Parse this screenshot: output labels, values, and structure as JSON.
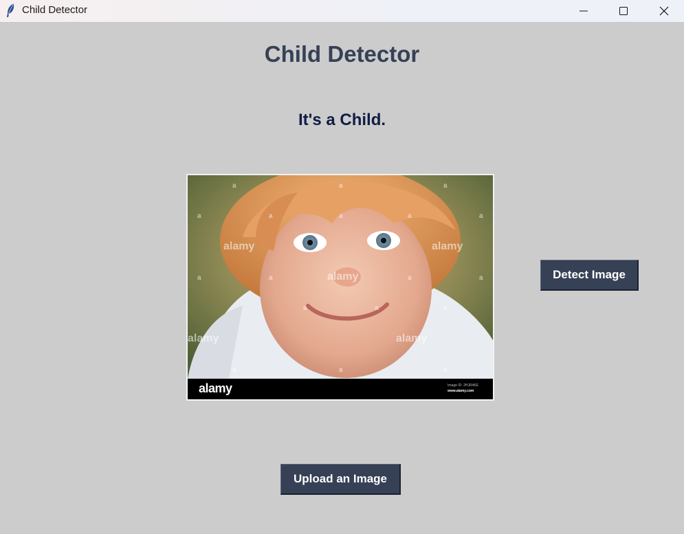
{
  "window": {
    "title": "Child Detector",
    "icon": "feather-icon",
    "controls": [
      "minimize-icon",
      "maximize-icon",
      "close-icon"
    ]
  },
  "main": {
    "heading": "Child Detector",
    "result_text": "It's a Child.",
    "image": {
      "watermark_brand": "alamy",
      "footer_logo": "alamy",
      "footer_id": "Image ID: 2HJR4KE",
      "footer_url": "www.alamy.com"
    },
    "detect_button_label": "Detect Image",
    "upload_button_label": "Upload an Image"
  },
  "colors": {
    "background": "#cccccc",
    "heading": "#364156",
    "result": "#0f1d45",
    "button_bg": "#364156",
    "button_text": "#ffffff"
  }
}
